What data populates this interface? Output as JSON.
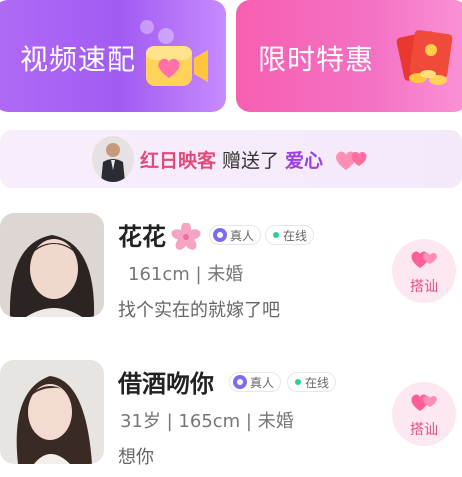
{
  "top_cards": {
    "video_match": {
      "title": "视频速配",
      "icon": "video-heart-icon"
    },
    "limited_offer": {
      "title": "限时特惠",
      "icon": "red-envelope-icon"
    }
  },
  "banner": {
    "sender": "红日映客",
    "action": "赠送了",
    "gift": "爱心",
    "icon": "hearts-icon"
  },
  "users": [
    {
      "name": "花花",
      "name_icon": "sakura-icon",
      "verified_tag": "真人",
      "online_tag": "在线",
      "meta": "161cm  | 未婚",
      "bio": "找个实在的就嫁了吧",
      "greet_label": "搭讪"
    },
    {
      "name": "借酒吻你",
      "verified_tag": "真人",
      "online_tag": "在线",
      "meta": "31岁 | 165cm  | 未婚",
      "bio": "想你",
      "greet_label": "搭讪"
    }
  ],
  "colors": {
    "video_card": "#a25bf2",
    "deal_card": "#f472c4",
    "banner_bg": "#f5ebfb",
    "sender": "#e34a7a",
    "gift": "#9b3fe6",
    "greet_bg": "#fde8f1",
    "online": "#2fd08a"
  }
}
